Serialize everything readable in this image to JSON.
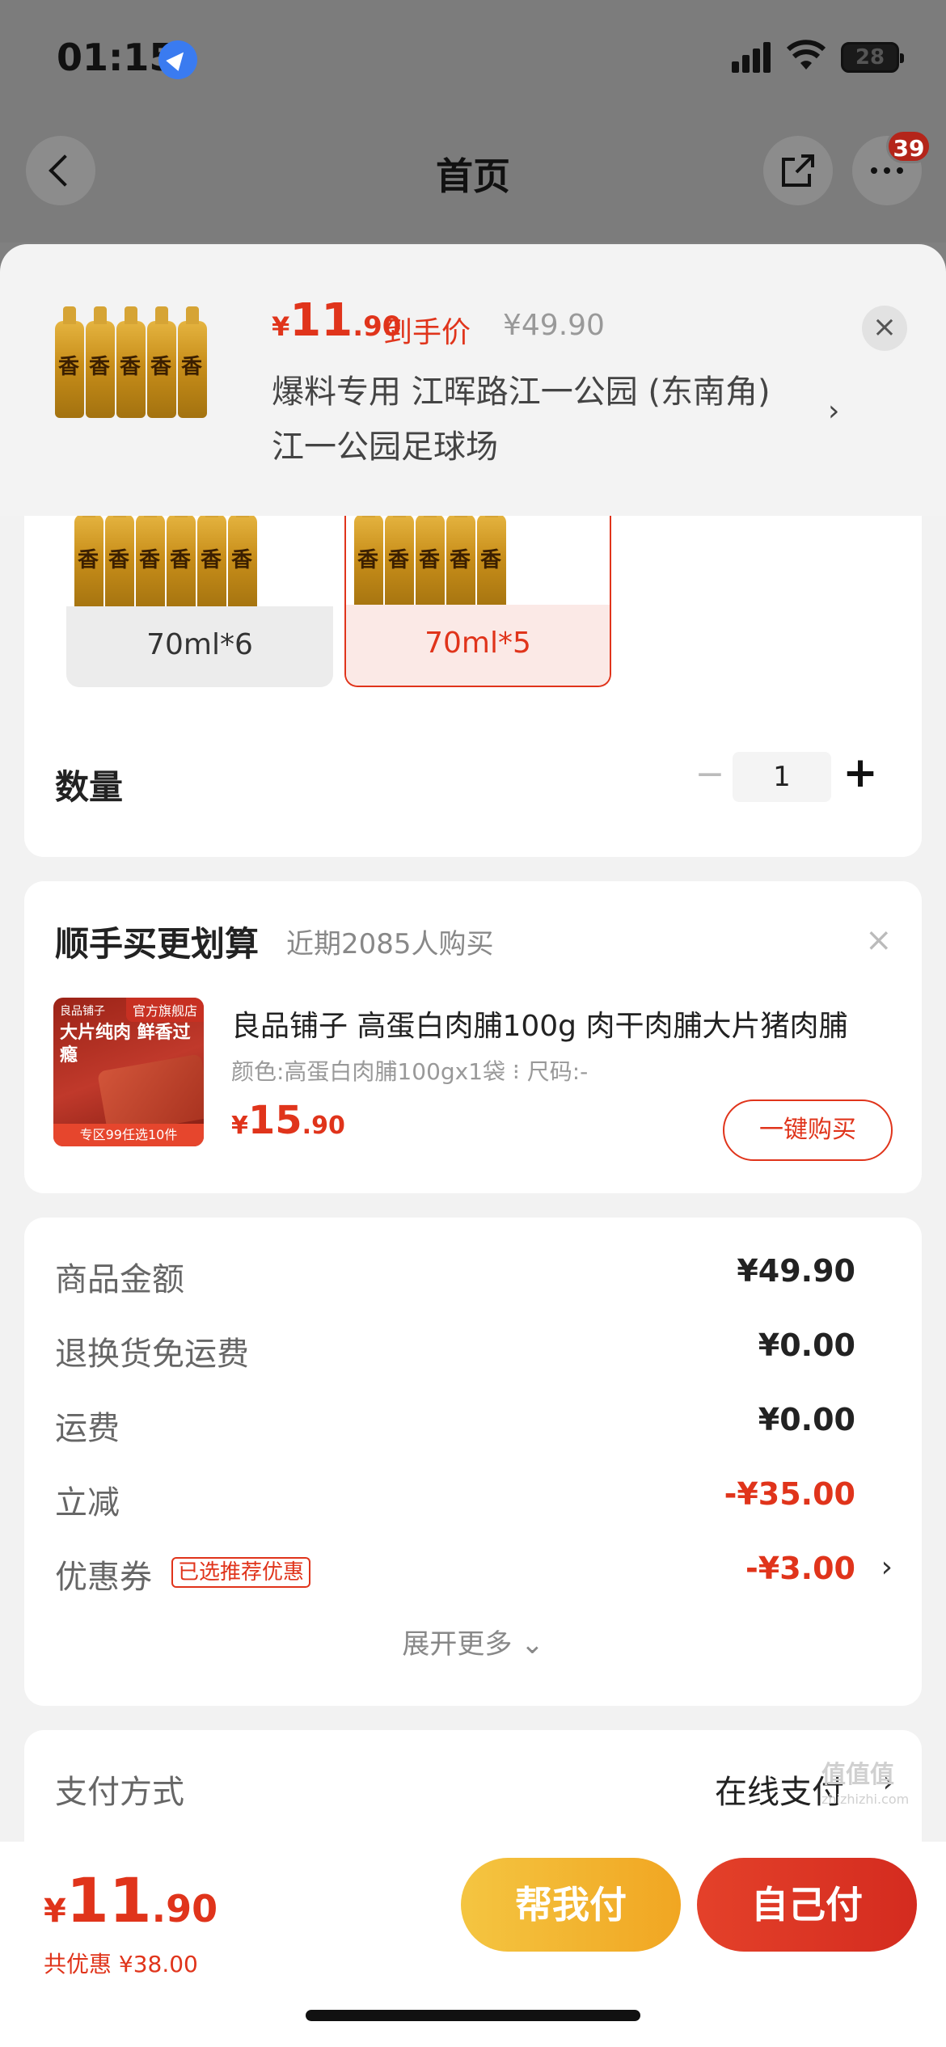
{
  "status_bar": {
    "time": "01:15",
    "battery": "28"
  },
  "nav": {
    "title": "首页",
    "badge": "39"
  },
  "product_header": {
    "price_symbol": "¥",
    "price_int": "11",
    "price_dec": ".90",
    "price_label": "到手价",
    "original_price": "¥49.90",
    "address_line1": "爆料专用  江晖路江一公园 (东南角)",
    "address_line2": "江一公园足球场",
    "arrow": "›",
    "close": "×"
  },
  "specs": [
    {
      "label": "70ml*6",
      "selected": false
    },
    {
      "label": "70ml*5",
      "selected": true
    }
  ],
  "quantity": {
    "label": "数量",
    "minus": "−",
    "value": "1",
    "plus": "+"
  },
  "upsell": {
    "title": "顺手买更划算",
    "subtitle": "近期2085人购买",
    "close": "×",
    "image_tag": "官方旗舰店",
    "image_brand": "良品铺子",
    "image_text": "大片纯肉 鲜香过瘾",
    "image_footer": "专区99任选10件",
    "name": "良品铺子 高蛋白肉脯100g 肉干肉脯大片猪肉脯",
    "attributes": "颜色:高蛋白肉脯100gx1袋 ⁝ 尺码:-",
    "price_symbol": "¥",
    "price_int": "15",
    "price_dec": ".90",
    "button": "一键购买"
  },
  "price_details": {
    "rows": [
      {
        "key": "商品金额",
        "value": "¥49.90"
      },
      {
        "key": "退换货免运费",
        "value": "¥0.00"
      },
      {
        "key": "运费",
        "value": "¥0.00"
      },
      {
        "key": "立减",
        "value": "-¥35.00"
      },
      {
        "key": "优惠券",
        "tag": "已选推荐优惠",
        "value": "-¥3.00"
      }
    ],
    "expand": "展开更多 ⌄"
  },
  "payment": {
    "label": "支付方式",
    "value": "在线支付",
    "arrow": "›"
  },
  "bottom_bar": {
    "price_symbol": "¥",
    "price_int": "11",
    "price_dec": ".90",
    "savings": "共优惠 ¥38.00",
    "help_pay": "帮我付",
    "self_pay": "自己付"
  },
  "watermark": {
    "main": "值值值",
    "sub": "zhizhizhi.com"
  },
  "colors": {
    "accent": "#e0341b",
    "help_button": "#f1a622",
    "self_button": "#d42b1f"
  }
}
